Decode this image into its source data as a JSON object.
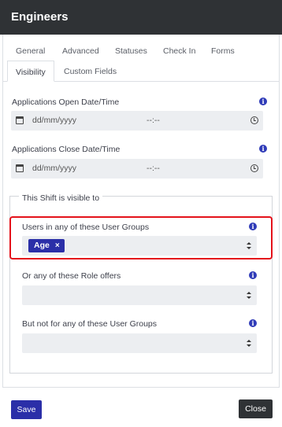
{
  "dialog": {
    "title": "Engineers"
  },
  "tabs": [
    {
      "label": "General",
      "active": false
    },
    {
      "label": "Advanced",
      "active": false
    },
    {
      "label": "Statuses",
      "active": false
    },
    {
      "label": "Check In",
      "active": false
    },
    {
      "label": "Forms",
      "active": false
    },
    {
      "label": "Visibility",
      "active": true
    },
    {
      "label": "Custom Fields",
      "active": false
    }
  ],
  "fields": {
    "open": {
      "label": "Applications Open Date/Time",
      "date_placeholder": "dd/mm/yyyy",
      "time_placeholder": "--:--",
      "info_icon": "info-icon",
      "calendar_icon": "calendar-icon",
      "clock_icon": "clock-icon"
    },
    "close": {
      "label": "Applications Close Date/Time",
      "date_placeholder": "dd/mm/yyyy",
      "time_placeholder": "--:--",
      "info_icon": "info-icon",
      "calendar_icon": "calendar-icon",
      "clock_icon": "clock-icon"
    }
  },
  "visibility": {
    "legend": "This Shift is visible to",
    "user_groups": {
      "label": "Users in any of these User Groups",
      "selected": [
        {
          "label": "Age",
          "remove": "×"
        }
      ]
    },
    "role_offers": {
      "label": "Or any of these Role offers",
      "selected": []
    },
    "exclude_groups": {
      "label": "But not for any of these User Groups",
      "selected": []
    }
  },
  "icons": {
    "info": "i",
    "chip_remove": "×"
  },
  "colors": {
    "header_bg": "#2f3235",
    "primary": "#2b2fa8",
    "highlight": "#e4121b",
    "info": "#2f3bb8"
  },
  "footer": {
    "save_label": "Save",
    "close_label": "Close"
  }
}
